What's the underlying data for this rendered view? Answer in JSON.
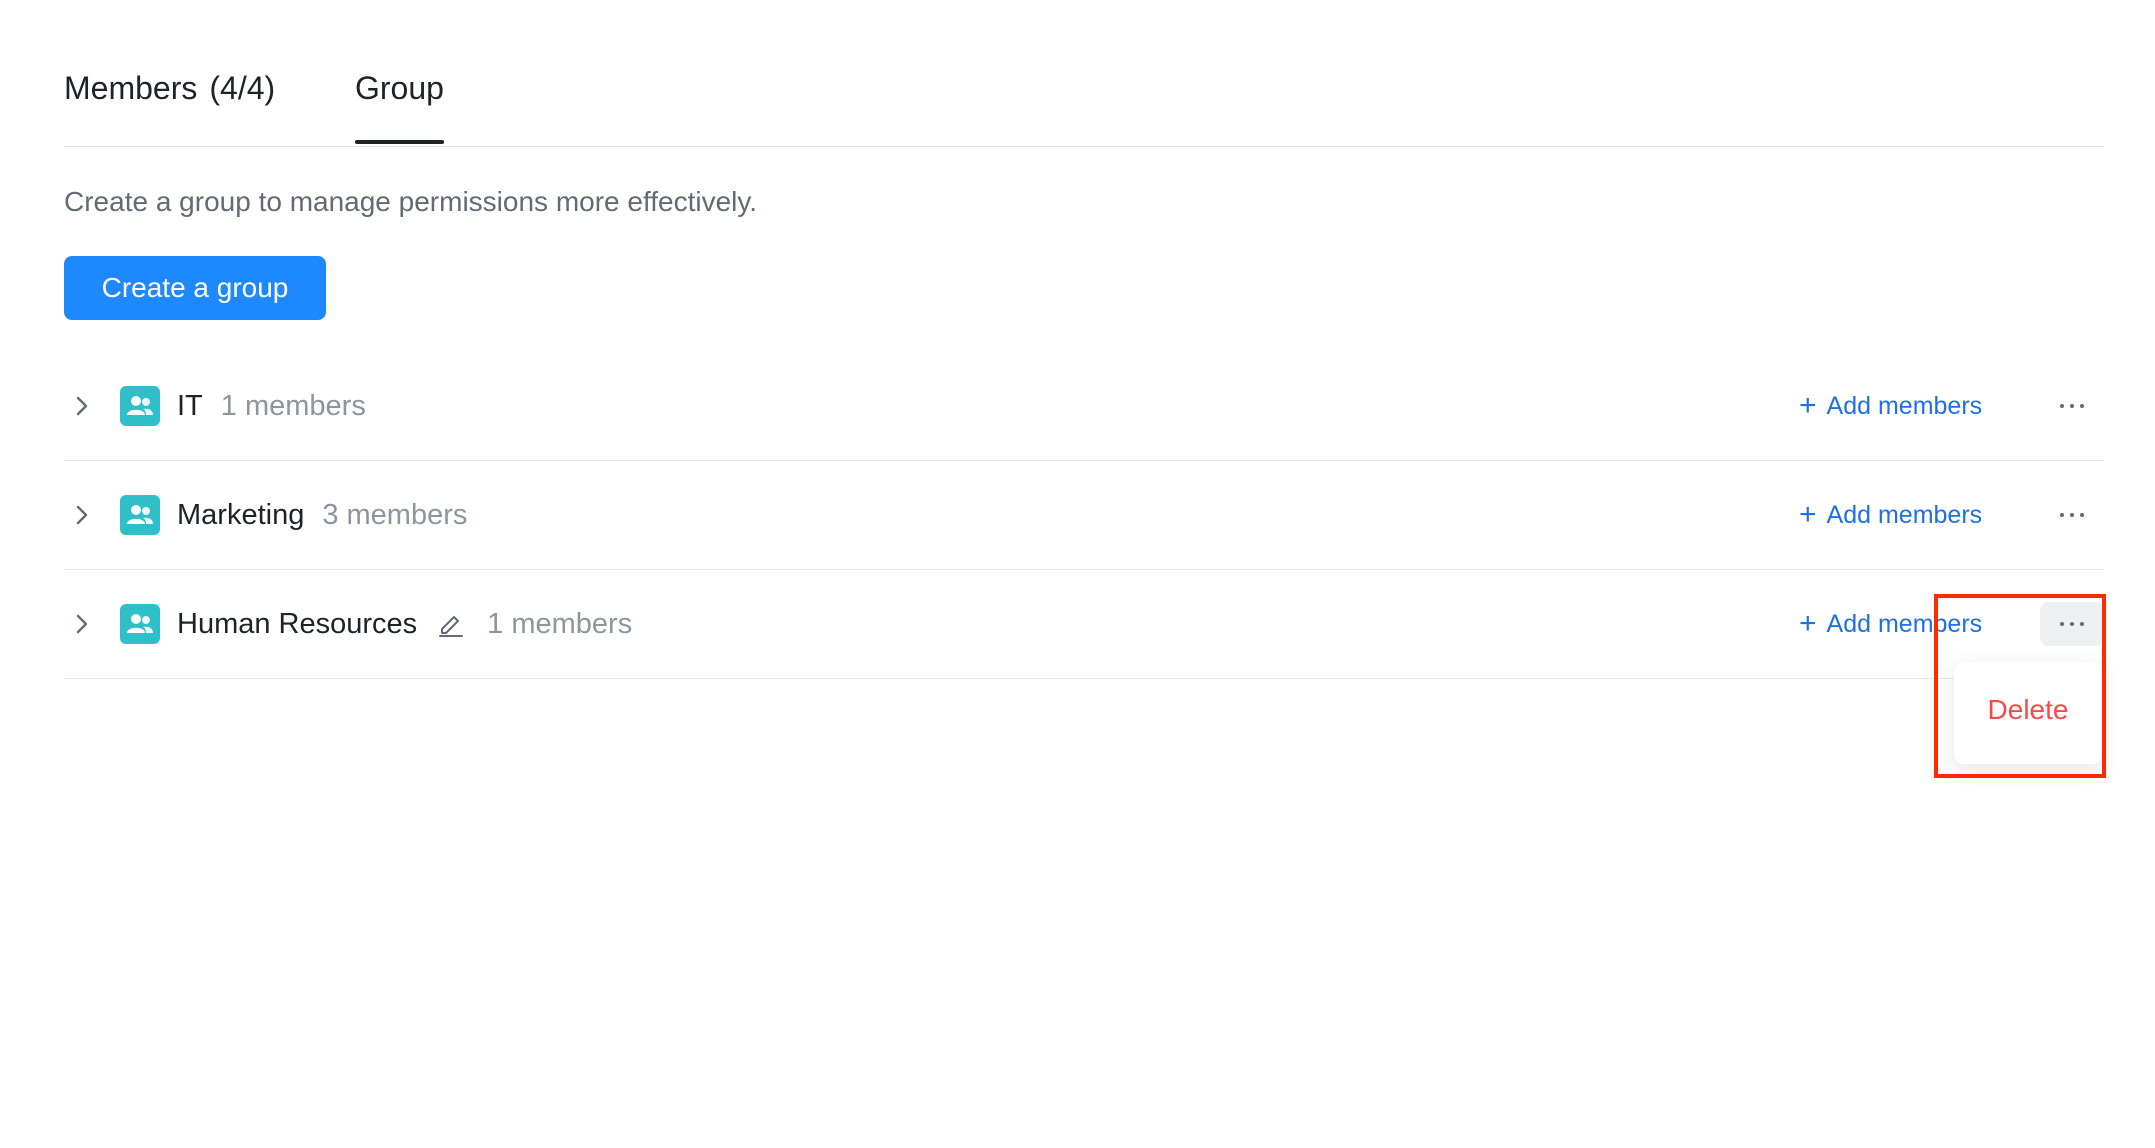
{
  "tabs": [
    {
      "label": "Members",
      "count": "(4/4)",
      "active": false
    },
    {
      "label": "Group",
      "active": true
    }
  ],
  "description": "Create a group to manage permissions more effectively.",
  "create_button": "Create a group",
  "groups": [
    {
      "name": "IT",
      "members": "1 members",
      "editable": false,
      "add_label": "Add members"
    },
    {
      "name": "Marketing",
      "members": "3 members",
      "editable": false,
      "add_label": "Add members"
    },
    {
      "name": "Human Resources",
      "members": "1 members",
      "editable": true,
      "add_label": "Add members"
    }
  ],
  "dropdown": {
    "delete_label": "Delete"
  },
  "colors": {
    "accent": "#1e88ff",
    "link": "#1e6fe8",
    "group_icon": "#2fbfc9",
    "danger": "#f54a45",
    "highlight": "#ff2a00"
  },
  "icons": {
    "expand": "chevron-right-icon",
    "group": "group-users-icon",
    "edit": "pencil-icon",
    "add": "plus-icon",
    "more": "more-horizontal-icon"
  }
}
